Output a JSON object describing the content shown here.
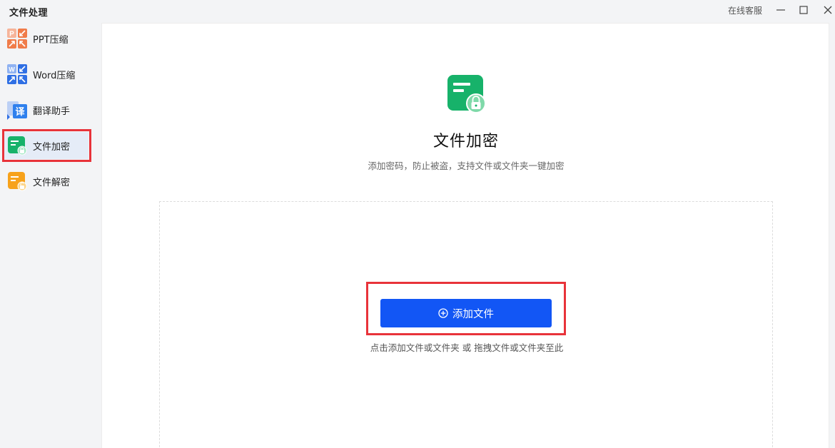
{
  "window": {
    "title": "文件处理",
    "support_label": "在线客服"
  },
  "sidebar": {
    "items": [
      {
        "label": "PPT压缩",
        "icon": "ppt-compress-icon",
        "active": false
      },
      {
        "label": "Word压缩",
        "icon": "word-compress-icon",
        "active": false
      },
      {
        "label": "翻译助手",
        "icon": "translate-icon",
        "active": false
      },
      {
        "label": "文件加密",
        "icon": "file-encrypt-icon",
        "active": true
      },
      {
        "label": "文件解密",
        "icon": "file-decrypt-icon",
        "active": false
      }
    ]
  },
  "main": {
    "title": "文件加密",
    "subtitle": "添加密码，防止被盗，支持文件或文件夹一键加密",
    "add_button": "添加文件",
    "drop_hint": "点击添加文件或文件夹 或 拖拽文件或文件夹至此"
  },
  "colors": {
    "primary": "#1256f5",
    "highlight": "#e8333a",
    "encrypt_green": "#17b26a",
    "ppt_orange": "#f07c4a",
    "word_blue": "#2f6fe4",
    "decrypt_orange": "#f7a21b"
  }
}
